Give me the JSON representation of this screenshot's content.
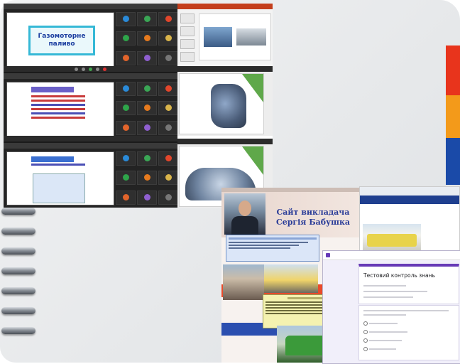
{
  "zoom": {
    "slide1_title": "Газомоторне паливо"
  },
  "site": {
    "title_line1": "Сайт викладача",
    "title_line2": "Сергія Бабушка"
  },
  "form": {
    "title": "Тестовий контроль знань"
  },
  "colors": {
    "strip_red": "#e8341c",
    "strip_orange": "#f39a1a",
    "strip_blue": "#1a4aa8",
    "form_accent": "#673ab7"
  },
  "icons": [
    "spiral-binding-icon"
  ]
}
